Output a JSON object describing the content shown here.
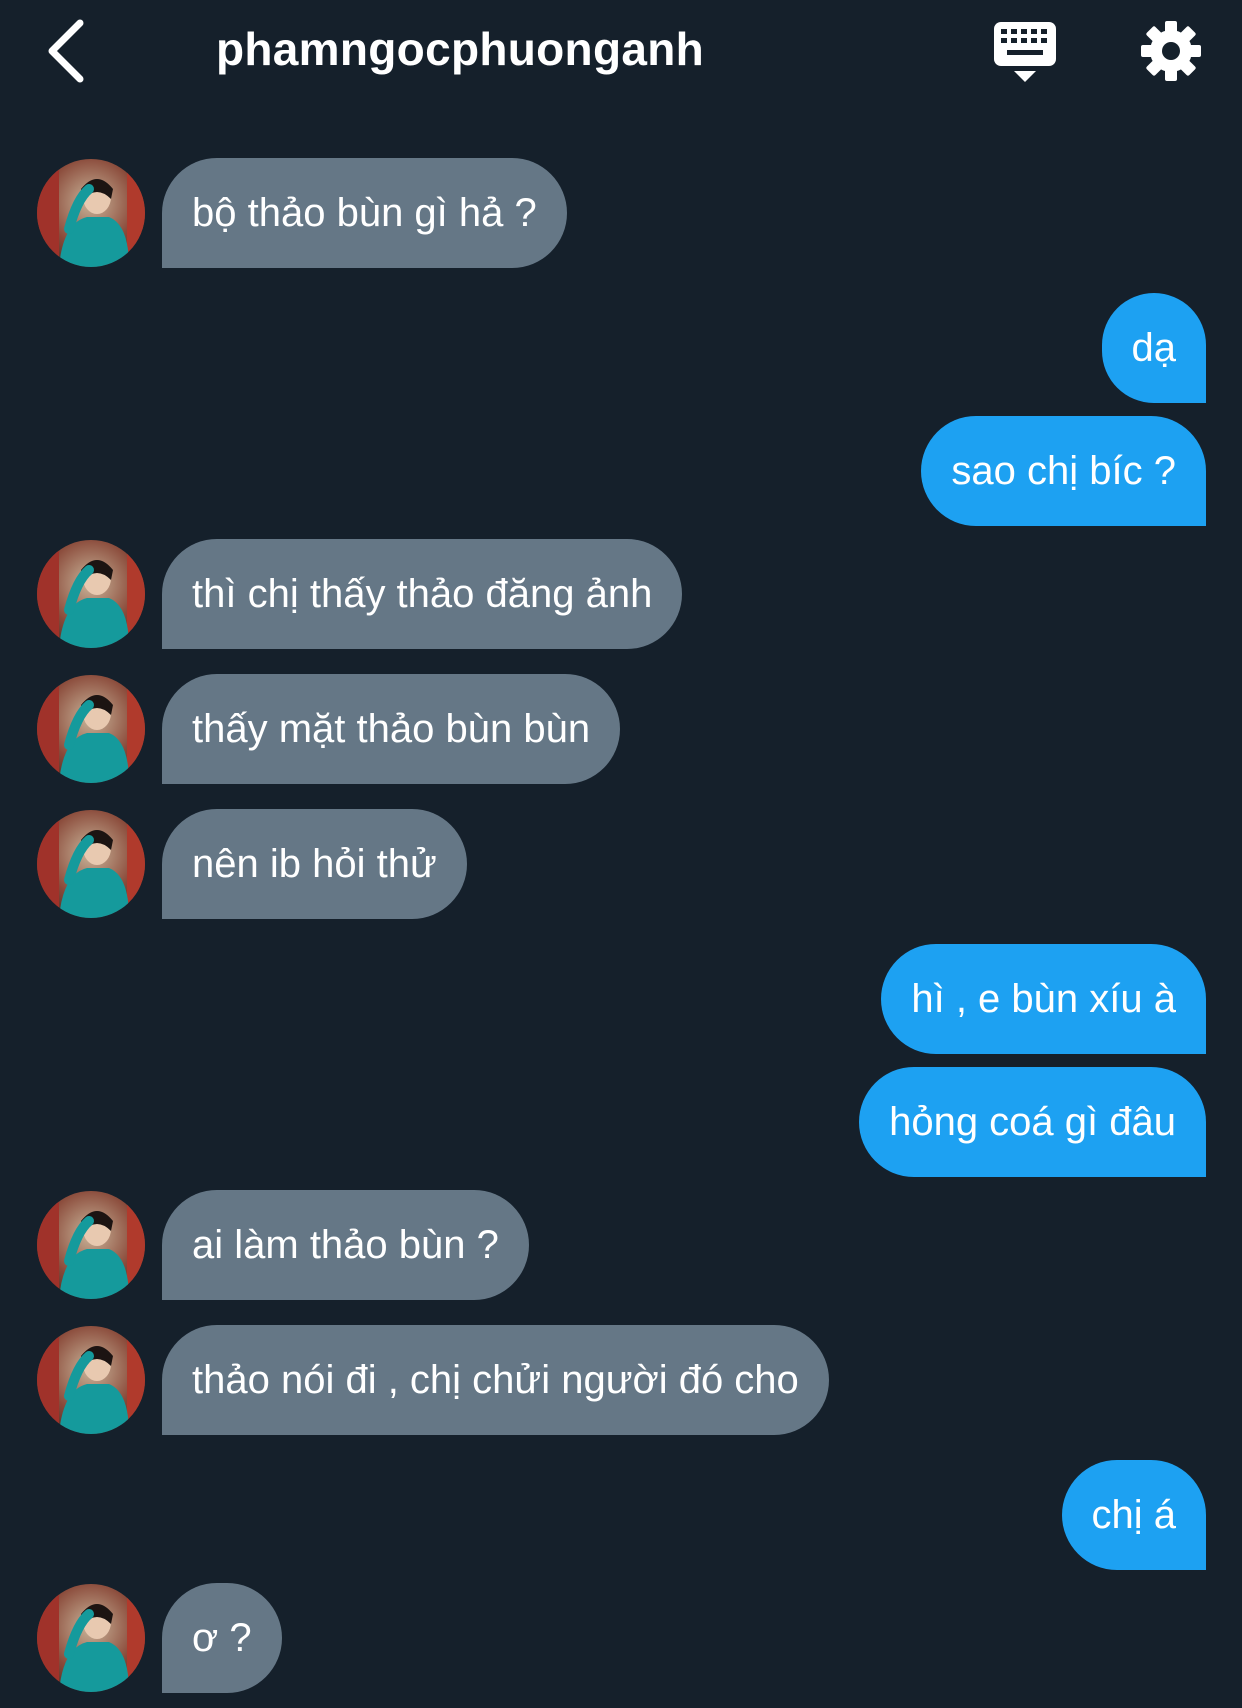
{
  "header": {
    "title": "phamngocphuonganh",
    "back_icon": "chevron-left-icon",
    "keyboard_icon": "keyboard-icon",
    "settings_icon": "gear-icon"
  },
  "colors": {
    "background": "#15202b",
    "incoming_bubble": "#657786",
    "outgoing_bubble": "#1da1f2",
    "text": "#ffffff"
  },
  "messages": [
    {
      "from": "them",
      "text": "bộ thảo bùn gì hả ?"
    },
    {
      "from": "me",
      "text": "dạ"
    },
    {
      "from": "me",
      "text": "sao chị bíc ?"
    },
    {
      "from": "them",
      "text": "thì chị thấy thảo đăng ảnh"
    },
    {
      "from": "them",
      "text": "thấy mặt thảo bùn bùn"
    },
    {
      "from": "them",
      "text": "nên ib hỏi thử"
    },
    {
      "from": "me",
      "text": "hì , e bùn xíu à"
    },
    {
      "from": "me",
      "text": "hỏng coá gì đâu"
    },
    {
      "from": "them",
      "text": "ai làm thảo bùn ?"
    },
    {
      "from": "them",
      "text": "thảo nói đi , chị chửi người đó cho"
    },
    {
      "from": "me",
      "text": "chị á"
    },
    {
      "from": "them",
      "text": "ơ ?"
    }
  ]
}
